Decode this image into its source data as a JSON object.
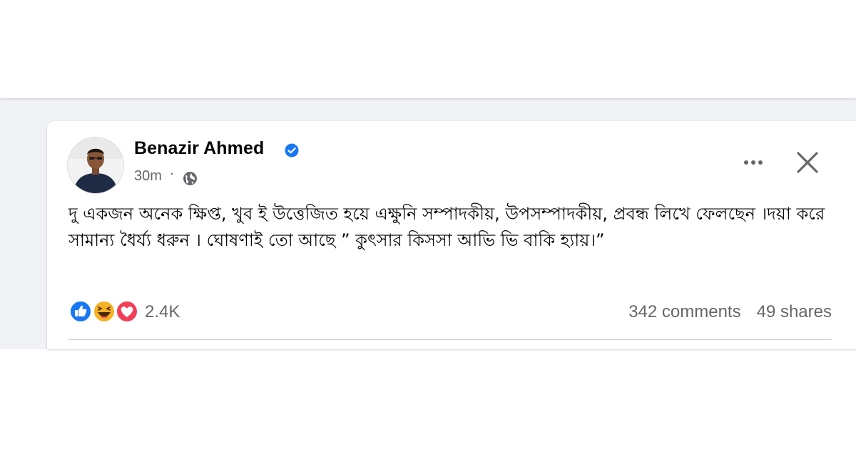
{
  "post": {
    "author": "Benazir Ahmed",
    "verified": true,
    "timestamp": "30m",
    "separator": "·",
    "audience_icon": "globe-icon",
    "text": "দু একজন অনেক ক্ষিপ্ত, খুব ই উত্তেজিত হয়ে এক্ষুনি সম্পাদকীয়, উপসম্পাদকীয়, প্রবন্ধ লিখে ফেলছেন ।দয়া করে সামান্য ধৈর্য্য ধরুন । ঘোষণাই তো আছে    ” কুৎসার কিসসা আভি ভি বাকি হ্যায়।”",
    "reactions": {
      "icons": [
        "like-icon",
        "haha-icon",
        "love-icon"
      ],
      "count": "2.4K"
    },
    "comments": "342 comments",
    "shares": "49 shares"
  },
  "colors": {
    "feed_background": "#f0f2f5",
    "text_primary": "#050505",
    "text_secondary": "#65676b",
    "verified_blue": "#1877f2",
    "like_blue": "#1877f2",
    "haha_yellow": "#f7b125",
    "love_red": "#f33e58",
    "divider": "#ced0d4"
  }
}
